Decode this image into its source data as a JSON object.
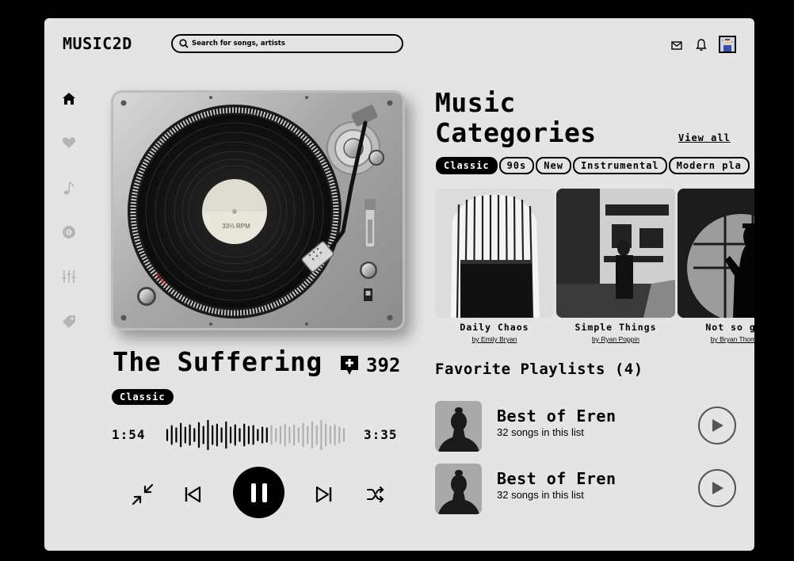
{
  "app": {
    "logo": "MUSIC2D"
  },
  "search": {
    "placeholder": "Search for songs, artists"
  },
  "topbar": {
    "icons": [
      "mail-icon",
      "bell-icon",
      "avatar"
    ]
  },
  "sidebar": {
    "items": [
      "home-icon",
      "heart-icon",
      "music-note-icon",
      "disc-icon",
      "equalizer-icon",
      "tag-icon"
    ],
    "active": "home-icon"
  },
  "now_playing": {
    "record_label": "33⅓ RPM",
    "title": "The Suffering",
    "add_count": "392",
    "genre": "Classic",
    "elapsed": "1:54",
    "duration": "3:35",
    "progress": 0.56
  },
  "categories": {
    "heading_line1": "Music",
    "heading_line2": "Categories",
    "view_all": "View all",
    "chips": [
      "Classic",
      "90s",
      "New",
      "Instrumental",
      "Modern pla"
    ],
    "cards": [
      {
        "name": "Daily Chaos",
        "by": "by Emily Bryan"
      },
      {
        "name": "Simple Things",
        "by": "by Ryan Poppin"
      },
      {
        "name": "Not so goo",
        "by": "by Bryan Thomas"
      }
    ]
  },
  "favorites": {
    "heading": "Favorite Playlists (4)",
    "items": [
      {
        "name": "Best of Eren",
        "sub": "32 songs in this list"
      },
      {
        "name": "Best of Eren",
        "sub": "32 songs in this list"
      }
    ]
  },
  "colors": {
    "background": "#000000",
    "panel": "#e4e4e4",
    "accent": "#000000"
  }
}
